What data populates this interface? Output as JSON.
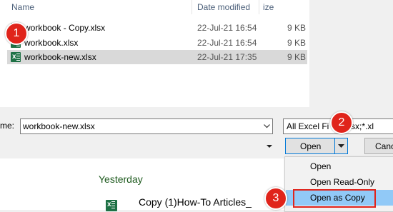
{
  "file_list": {
    "headers": {
      "name": "Name",
      "date": "Date modified",
      "size": "ize"
    },
    "rows": [
      {
        "name": "workbook - Copy.xlsx",
        "date": "22-Jul-21 16:54",
        "size": "9 KB",
        "selected": false
      },
      {
        "name": "workbook.xlsx",
        "date": "22-Jul-21 16:54",
        "size": "9 KB",
        "selected": false
      },
      {
        "name": "workbook-new.xlsx",
        "date": "22-Jul-21 17:35",
        "size": "9 KB",
        "selected": true
      }
    ]
  },
  "filename": {
    "label": "me:",
    "value": "workbook-new.xlsx"
  },
  "filter": {
    "value": "All Excel Fi l*;*.xlsx;*.xl"
  },
  "buttons": {
    "open": "Open",
    "cancel": "Canc"
  },
  "open_menu": {
    "items": [
      {
        "label": "Open",
        "highlighted": false
      },
      {
        "label": "Open Read-Only",
        "highlighted": false
      },
      {
        "label": "Open as Copy",
        "highlighted": true
      }
    ]
  },
  "recent": {
    "group": "Yesterday",
    "item": "Copy (1)How-To Articles_"
  },
  "steps": [
    "1",
    "2",
    "3"
  ],
  "colors": {
    "accent_blue": "#0078d7",
    "step_red": "#e0241b",
    "excel_green": "#1e7145",
    "menu_highlight": "#91c9f7"
  }
}
